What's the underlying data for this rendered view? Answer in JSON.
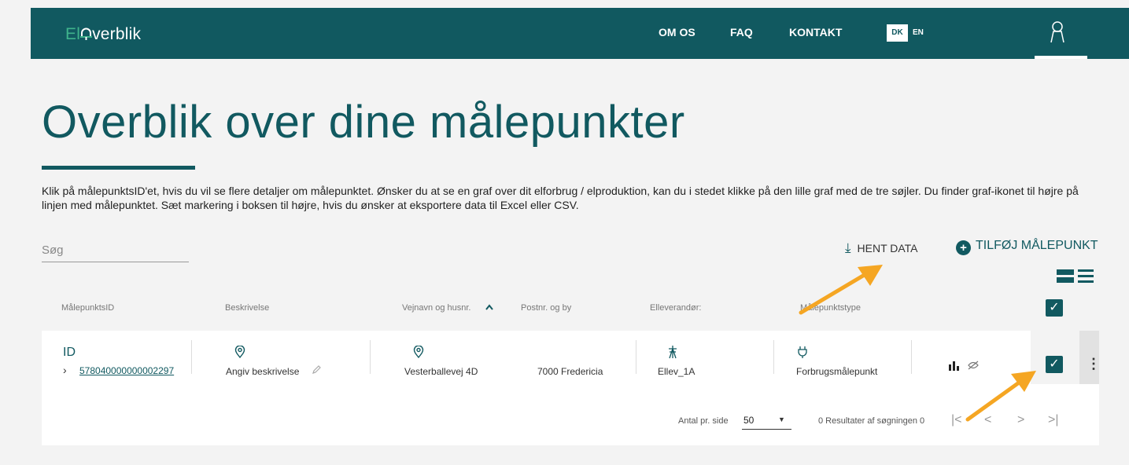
{
  "app": {
    "logo_prefix": "El",
    "logo_suffix": "verblik"
  },
  "nav": {
    "om_os": "OM OS",
    "faq": "FAQ",
    "kontakt": "KONTAKT",
    "lang_dk": "DK",
    "lang_en": "EN"
  },
  "page": {
    "title": "Overblik over dine målepunkter",
    "description": "Klik på målepunktsID'et, hvis du vil se flere detaljer om målepunktet. Ønsker du at se en graf over dit elforbrug / elproduktion, kan du i stedet klikke på den lille graf med de tre søjler. Du finder graf-ikonet til højre på linjen med målepunktet. Sæt markering i boksen til højre, hvis du ønsker at eksportere data til Excel eller CSV."
  },
  "toolbar": {
    "search_placeholder": "Søg",
    "hent_data": "HENT DATA",
    "tilfoj": "TILFØJ MÅLEPUNKT"
  },
  "table": {
    "headers": {
      "id": "MålepunktsID",
      "beskrivelse": "Beskrivelse",
      "vejnavn": "Vejnavn og husnr.",
      "postnr": "Postnr. og by",
      "elleverandor": "Elleverandør:",
      "type": "Målepunktstype"
    },
    "row": {
      "id_label": "ID",
      "id_value": "578040000000002297",
      "beskrivelse": "Angiv beskrivelse",
      "vejnavn": "Vesterballevej 4D",
      "postnr": "7000 Fredericia",
      "elleverandor": "Ellev_1A",
      "type": "Forbrugsmålepunkt"
    }
  },
  "footer": {
    "per_page_label": "Antal pr. side",
    "per_page_value": "50",
    "results": "0 Resultater af søgningen 0"
  },
  "colors": {
    "brand": "#115960",
    "accent_green": "#3fb38c",
    "annotation_arrow": "#f5a623"
  }
}
